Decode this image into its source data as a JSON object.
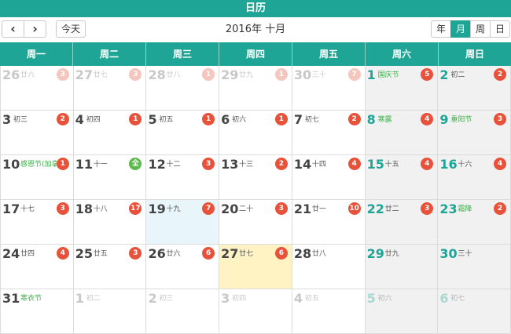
{
  "app": {
    "title": "日历"
  },
  "toolbar": {
    "prev_label": "‹",
    "next_label": "›",
    "today_label": "今天",
    "month_title": "2016年 十月",
    "views": [
      {
        "label": "年",
        "active": false
      },
      {
        "label": "月",
        "active": true
      },
      {
        "label": "周",
        "active": false
      },
      {
        "label": "日",
        "active": false
      }
    ]
  },
  "weekdays": [
    "周一",
    "周二",
    "周三",
    "周四",
    "周五",
    "周六",
    "周日"
  ],
  "colors": {
    "accent": "#1ea596",
    "badge": "#e8523a",
    "badge_faded": "#f5c6bd",
    "badge_full": "#5cb94c",
    "holiday_text": "#3cb048"
  },
  "weeks": [
    [
      {
        "day": "26",
        "lunar": "廿六",
        "badge": "3",
        "other": true
      },
      {
        "day": "27",
        "lunar": "廿七",
        "badge": "3",
        "other": true
      },
      {
        "day": "28",
        "lunar": "廿八",
        "badge": "1",
        "other": true
      },
      {
        "day": "29",
        "lunar": "廿九",
        "badge": "1",
        "other": true
      },
      {
        "day": "30",
        "lunar": "三十",
        "badge": "7",
        "other": true
      },
      {
        "day": "1",
        "lunar": "国庆节",
        "badge": "5",
        "holiday": true
      },
      {
        "day": "2",
        "lunar": "初二",
        "badge": "2"
      }
    ],
    [
      {
        "day": "3",
        "lunar": "初三",
        "badge": "2"
      },
      {
        "day": "4",
        "lunar": "初四",
        "badge": "1"
      },
      {
        "day": "5",
        "lunar": "初五",
        "badge": "1"
      },
      {
        "day": "6",
        "lunar": "初六",
        "badge": "1"
      },
      {
        "day": "7",
        "lunar": "初七",
        "badge": "2"
      },
      {
        "day": "8",
        "lunar": "寒露",
        "badge": "4",
        "holiday": true
      },
      {
        "day": "9",
        "lunar": "重阳节",
        "badge": "3",
        "holiday": true
      }
    ],
    [
      {
        "day": "10",
        "lunar": "感恩节(加拿",
        "badge": "1",
        "holiday": true
      },
      {
        "day": "11",
        "lunar": "十一",
        "badge": "全",
        "badge_style": "green"
      },
      {
        "day": "12",
        "lunar": "十二",
        "badge": "3"
      },
      {
        "day": "13",
        "lunar": "十三",
        "badge": "2"
      },
      {
        "day": "14",
        "lunar": "十四",
        "badge": "4"
      },
      {
        "day": "15",
        "lunar": "十五",
        "badge": "4"
      },
      {
        "day": "16",
        "lunar": "十六",
        "badge": "4"
      }
    ],
    [
      {
        "day": "17",
        "lunar": "十七",
        "badge": "3"
      },
      {
        "day": "18",
        "lunar": "十八",
        "badge": "17"
      },
      {
        "day": "19",
        "lunar": "十九",
        "badge": "7",
        "highlight": "blue"
      },
      {
        "day": "20",
        "lunar": "二十",
        "badge": "3"
      },
      {
        "day": "21",
        "lunar": "廿一",
        "badge": "10"
      },
      {
        "day": "22",
        "lunar": "廿二",
        "badge": "3"
      },
      {
        "day": "23",
        "lunar": "霜降",
        "badge": "2",
        "holiday": true
      }
    ],
    [
      {
        "day": "24",
        "lunar": "廿四",
        "badge": "4"
      },
      {
        "day": "25",
        "lunar": "廿五",
        "badge": "3"
      },
      {
        "day": "26",
        "lunar": "廿六",
        "badge": "6"
      },
      {
        "day": "27",
        "lunar": "廿七",
        "badge": "6",
        "highlight": "today"
      },
      {
        "day": "28",
        "lunar": "廿八"
      },
      {
        "day": "29",
        "lunar": "廿九"
      },
      {
        "day": "30",
        "lunar": "三十"
      }
    ],
    [
      {
        "day": "31",
        "lunar": "寒衣节",
        "holiday": true
      },
      {
        "day": "1",
        "lunar": "初二",
        "other": true
      },
      {
        "day": "2",
        "lunar": "初三",
        "other": true
      },
      {
        "day": "3",
        "lunar": "初四",
        "other": true
      },
      {
        "day": "4",
        "lunar": "初五",
        "other": true
      },
      {
        "day": "5",
        "lunar": "初六",
        "other": true
      },
      {
        "day": "6",
        "lunar": "初七",
        "other": true
      }
    ]
  ]
}
